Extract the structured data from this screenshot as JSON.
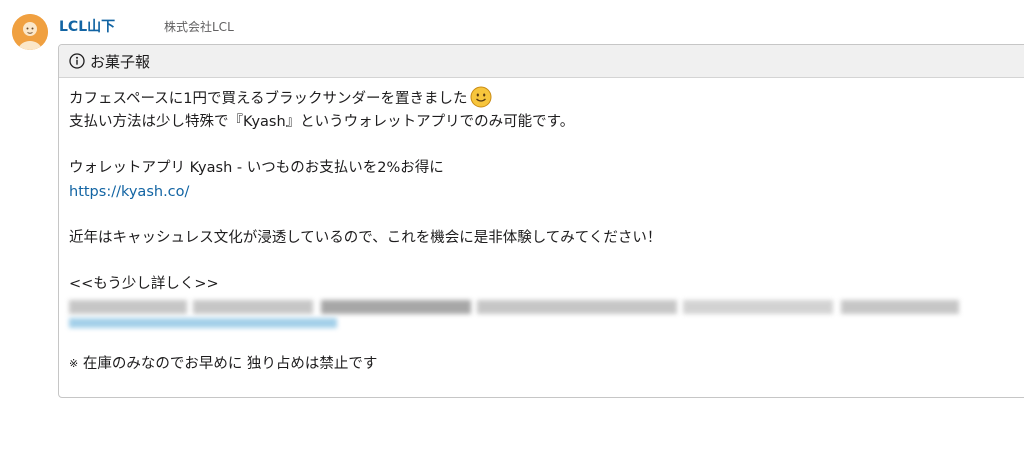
{
  "post": {
    "author": "LCL山下",
    "organization": "株式会社LCL",
    "avatar_icon": "user-avatar-icon"
  },
  "card": {
    "title": "お菓子報",
    "icon": "info-icon",
    "lines": {
      "l1": "カフェスペースに1円で買えるブラックサンダーを置きました",
      "l2": "支払い方法は少し特殊で『Kyash』というウォレットアプリでのみ可能です。",
      "l3": "ウォレットアプリ Kyash - いつものお支払いを2%お得に",
      "link": "https://kyash.co/",
      "l4": "近年はキャッシュレス文化が浸透しているので、これを機会に是非体験してみてください！",
      "l5": "<<もう少し詳しく>>",
      "note_mark": "※",
      "l6": " 在庫のみなのでお早めに 独り占めは禁止です"
    },
    "emoji": "smiley-emoji-icon"
  },
  "colors": {
    "author": "#1264a3",
    "link": "#1264a3",
    "header_bg": "#f0f0f0",
    "avatar_bg": "#f0a040"
  }
}
